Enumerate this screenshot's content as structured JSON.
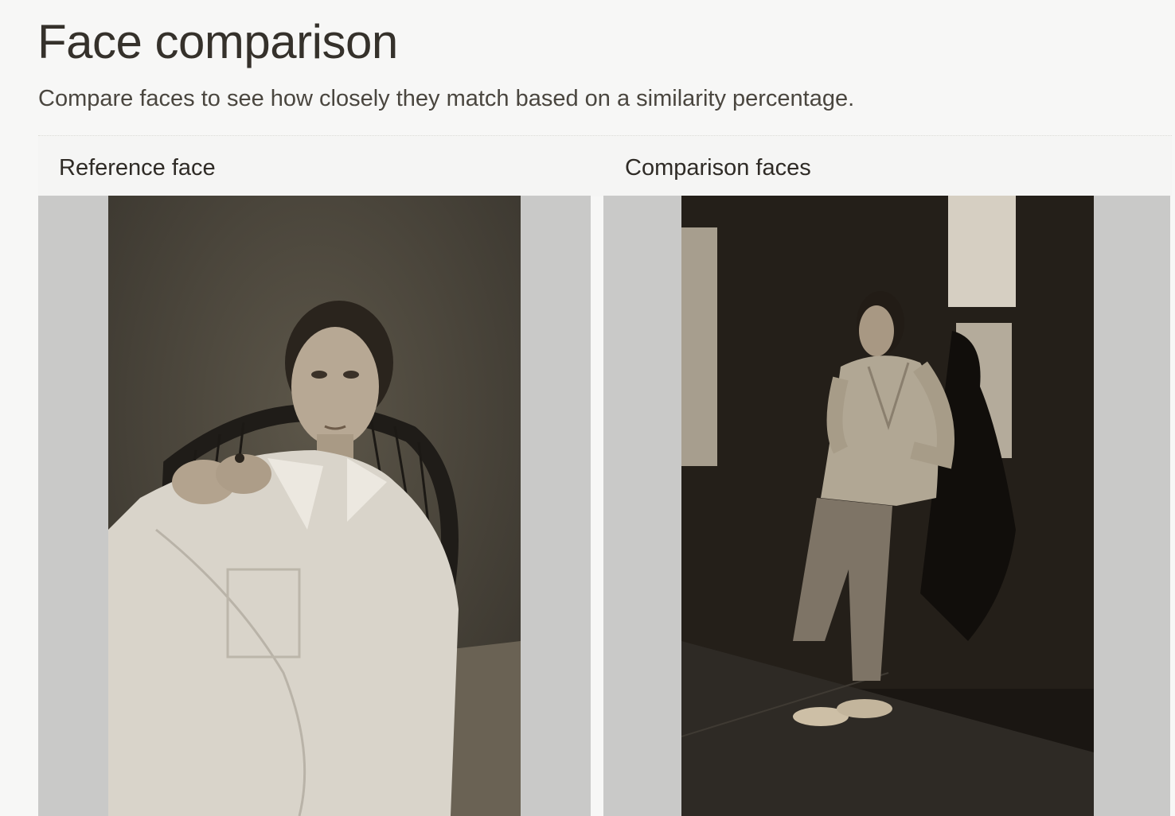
{
  "header": {
    "title": "Face comparison",
    "subtitle": "Compare faces to see how closely they match based on a similarity percentage."
  },
  "reference": {
    "label": "Reference face",
    "image_alt": "Woman in white shirt seated in a woven chair"
  },
  "comparison": {
    "label": "Comparison faces",
    "image_alt": "Woman leaning against a dark wall in sunlight"
  },
  "colors": {
    "frame_background": "#c9c9c8",
    "page_background": "#f7f7f6"
  }
}
